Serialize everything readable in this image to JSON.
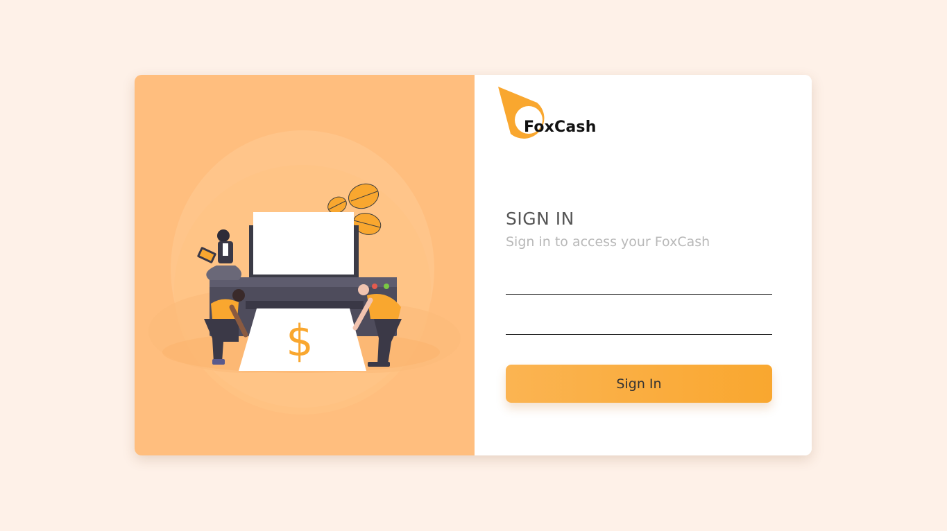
{
  "brand": {
    "name": "FoxCash",
    "logo_icon": "foxcash-logo-icon",
    "accent_color": "#f9a72f"
  },
  "signin": {
    "title": "SIGN IN",
    "subtitle": "Sign in to access your FoxCash",
    "email_value": "",
    "password_value": "",
    "button_label": "Sign In"
  },
  "illustration": {
    "description_icon": "printing-money-illustration",
    "printed_symbol": "$"
  },
  "colors": {
    "page_background": "#fef1e8",
    "left_panel": "#ffbe7e",
    "button": "#f9a72f",
    "title_text": "#555555",
    "subtitle_text": "#b8b8b8"
  }
}
